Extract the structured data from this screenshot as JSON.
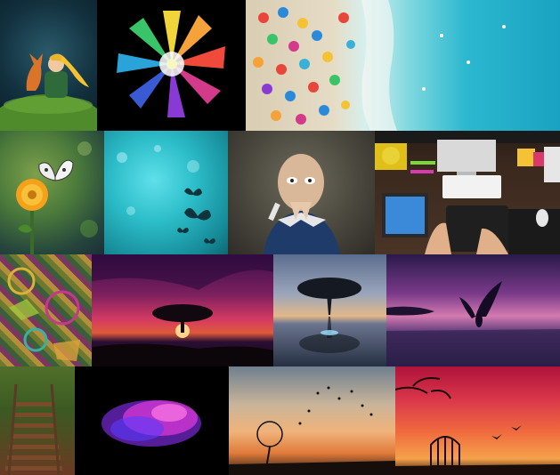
{
  "collage": {
    "tiles": [
      {
        "name": "little-prince-fox-painting",
        "icon": "fox-icon"
      },
      {
        "name": "rainbow-powder-explosion",
        "icon": "burst-icon"
      },
      {
        "name": "aerial-beach-umbrellas",
        "icon": "umbrella-icon"
      },
      {
        "name": "butterfly-on-marigold",
        "icon": "butterfly-icon"
      },
      {
        "name": "teal-bokeh-butterflies",
        "icon": "butterfly-icon"
      },
      {
        "name": "bald-figurine-sculpture",
        "icon": "figure-icon"
      },
      {
        "name": "designer-desk-tablet",
        "icon": "desk-icon"
      },
      {
        "name": "colorful-mosaic-art",
        "icon": "mosaic-icon"
      },
      {
        "name": "sunset-tree-silhouette",
        "icon": "tree-icon"
      },
      {
        "name": "tree-reflection-lake",
        "icon": "tree-icon"
      },
      {
        "name": "winged-angel-sunset",
        "icon": "wing-icon"
      },
      {
        "name": "forest-wooden-stairs",
        "icon": "stairs-icon"
      },
      {
        "name": "magenta-smoke-cloud",
        "icon": "cloud-icon"
      },
      {
        "name": "dandelion-seeds-sunset",
        "icon": "dandelion-icon"
      },
      {
        "name": "birdcage-birds-sunset",
        "icon": "cage-icon"
      }
    ]
  }
}
